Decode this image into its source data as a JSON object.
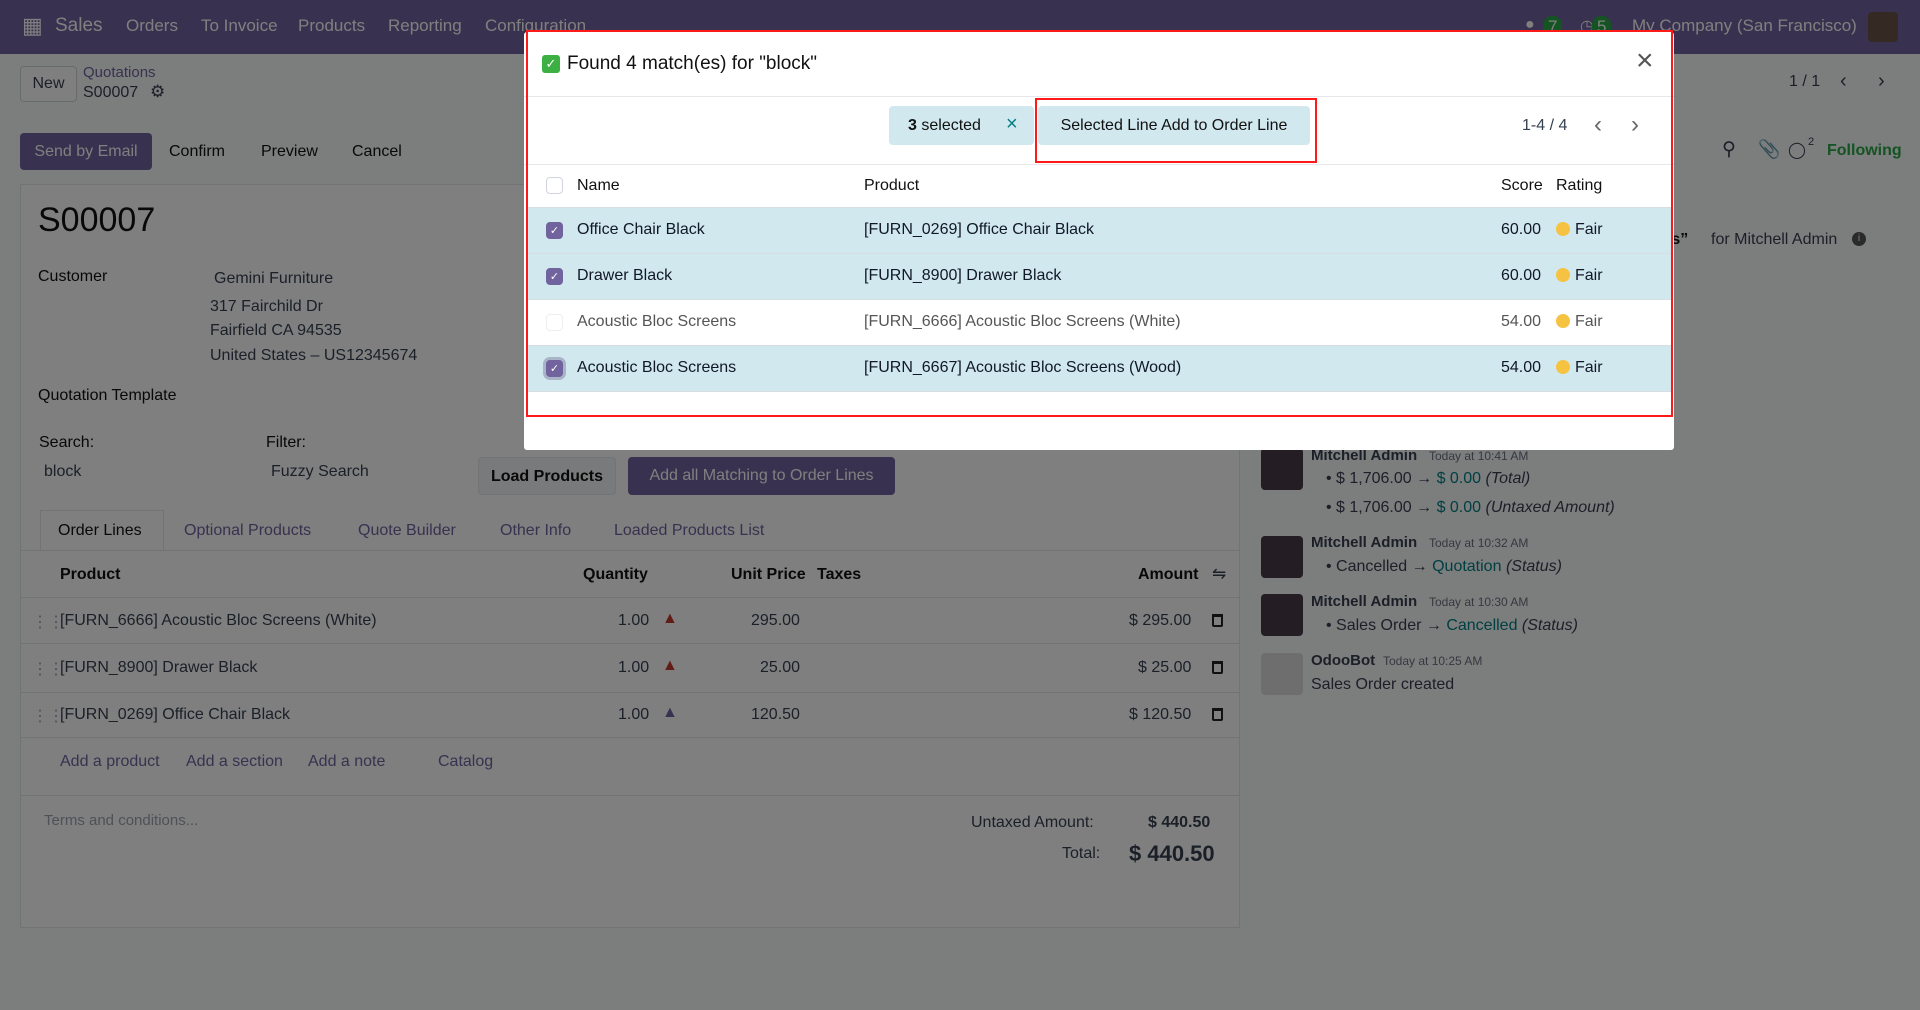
{
  "navbar": {
    "app": "Sales",
    "menu": [
      "Orders",
      "To Invoice",
      "Products",
      "Reporting",
      "Configuration"
    ],
    "chat_count": "7",
    "activity_count": "5",
    "company": "My Company (San Francisco)"
  },
  "control": {
    "new": "New",
    "breadcrumb": "Quotations",
    "record": "S00007",
    "pager": "1 / 1"
  },
  "actions": {
    "send": "Send by Email",
    "confirm": "Confirm",
    "preview": "Preview",
    "cancel": "Cancel"
  },
  "chatter_top": {
    "followers": "2",
    "following": "Following",
    "partial": "ts”",
    "for_user": "for Mitchell Admin"
  },
  "form": {
    "title": "S00007",
    "customer_label": "Customer",
    "customer": "Gemini Furniture",
    "addr1": "317 Fairchild Dr",
    "addr2": "Fairfield CA 94535",
    "addr3": "United States – US12345674",
    "template_label": "Quotation Template",
    "search_label": "Search:",
    "search_value": "block",
    "filter_label": "Filter:",
    "filter_value": "Fuzzy Search",
    "load": "Load Products",
    "add_all": "Add all Matching to Order Lines"
  },
  "tabs": [
    "Order Lines",
    "Optional Products",
    "Quote Builder",
    "Other Info",
    "Loaded Products List"
  ],
  "lines": {
    "headers": {
      "product": "Product",
      "qty": "Quantity",
      "price": "Unit Price",
      "taxes": "Taxes",
      "amount": "Amount"
    },
    "rows": [
      {
        "product": "[FURN_6666] Acoustic Bloc Screens (White)",
        "qty": "1.00",
        "price": "295.00",
        "amount": "$ 295.00",
        "forecast": "#c0392b"
      },
      {
        "product": "[FURN_8900] Drawer Black",
        "qty": "1.00",
        "price": "25.00",
        "amount": "$ 25.00",
        "forecast": "#c0392b"
      },
      {
        "product": "[FURN_0269] Office Chair Black",
        "qty": "1.00",
        "price": "120.50",
        "amount": "$ 120.50",
        "forecast": "#71639e"
      }
    ],
    "add_product": "Add a product",
    "add_section": "Add a section",
    "add_note": "Add a note",
    "catalog": "Catalog"
  },
  "totals": {
    "terms_placeholder": "Terms and conditions...",
    "untaxed_label": "Untaxed Amount:",
    "untaxed": "$ 440.50",
    "total_label": "Total:",
    "total": "$ 440.50"
  },
  "chatter": [
    {
      "author": "Mitchell Admin",
      "time": "Today at 10:41 AM",
      "items": [
        {
          "old": "$ 1,706.00",
          "new": "$ 0.00",
          "field": "(Total)"
        },
        {
          "old": "$ 1,706.00",
          "new": "$ 0.00",
          "field": "(Untaxed Amount)"
        }
      ]
    },
    {
      "author": "Mitchell Admin",
      "time": "Today at 10:32 AM",
      "items": [
        {
          "old": "Cancelled",
          "new": "Quotation",
          "field": "(Status)"
        }
      ]
    },
    {
      "author": "Mitchell Admin",
      "time": "Today at 10:30 AM",
      "items": [
        {
          "old": "Sales Order",
          "new": "Cancelled",
          "field": "(Status)"
        }
      ]
    },
    {
      "author": "OdooBot",
      "time": "Today at 10:25 AM",
      "body": "Sales Order created"
    }
  ],
  "modal": {
    "title": "Found 4 match(es) for \"block\"",
    "selected_count": "3",
    "selected_label": "selected",
    "add_button": "Selected Line Add to Order Line",
    "pager": "1-4 / 4",
    "headers": {
      "name": "Name",
      "product": "Product",
      "score": "Score",
      "rating": "Rating"
    },
    "rows": [
      {
        "name": "Office Chair Black",
        "product": "[FURN_0269] Office Chair Black",
        "score": "60.00",
        "rating": "Fair",
        "checked": true
      },
      {
        "name": "Drawer Black",
        "product": "[FURN_8900] Drawer Black",
        "score": "60.00",
        "rating": "Fair",
        "checked": true
      },
      {
        "name": "Acoustic Bloc Screens",
        "product": "[FURN_6666] Acoustic Bloc Screens (White)",
        "score": "54.00",
        "rating": "Fair",
        "checked": false
      },
      {
        "name": "Acoustic Bloc Screens",
        "product": "[FURN_6667] Acoustic Bloc Screens (Wood)",
        "score": "54.00",
        "rating": "Fair",
        "checked": true
      }
    ]
  },
  "colors": {
    "brand": "#71639e",
    "highlight": "#ff1a1a",
    "selected_row": "#d1e8ef",
    "link": "#017e84"
  }
}
